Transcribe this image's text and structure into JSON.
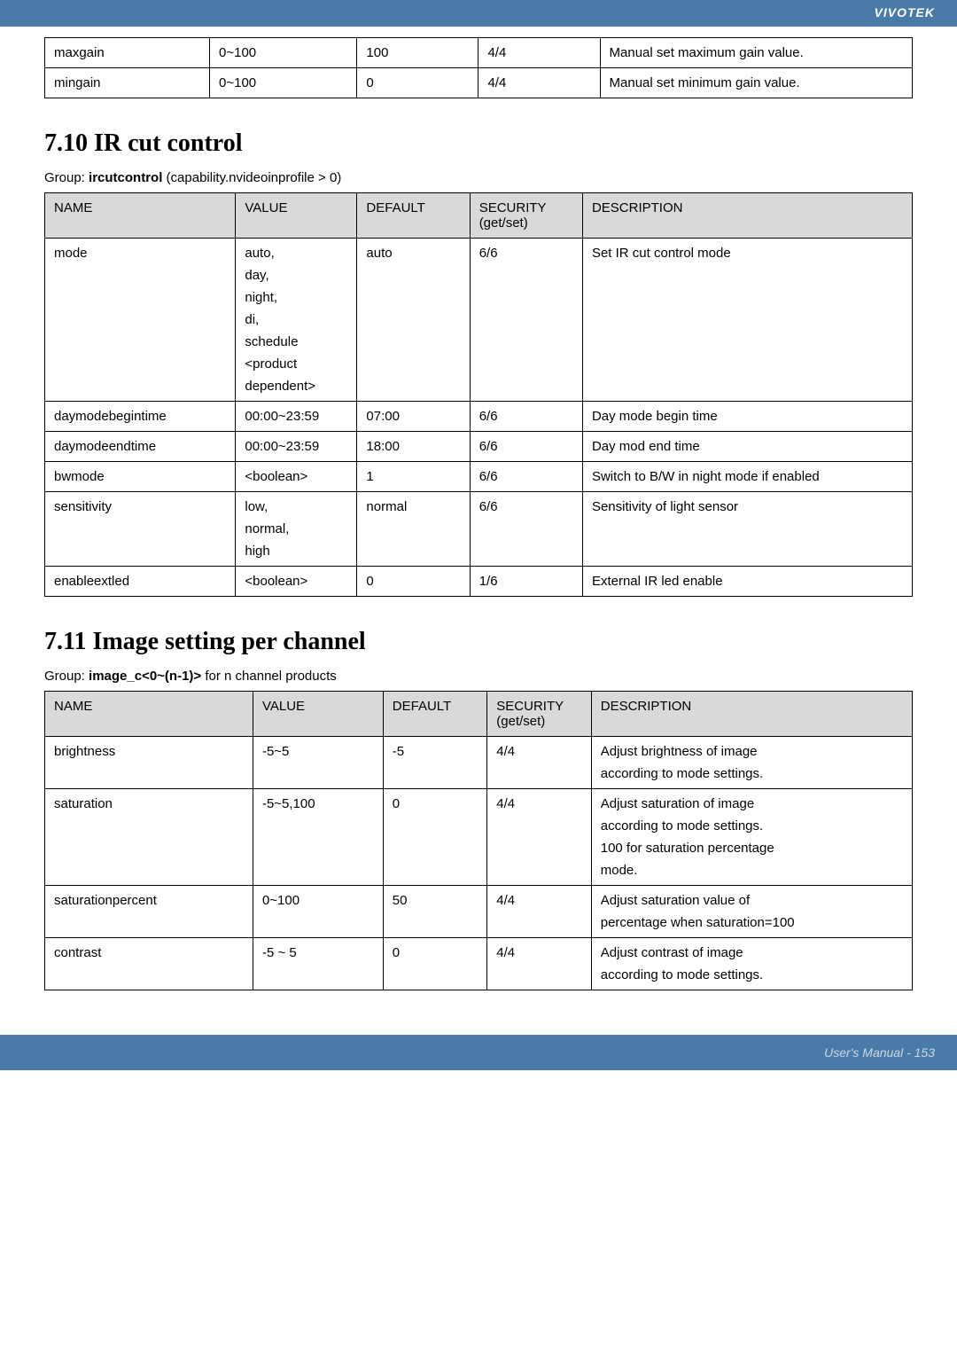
{
  "brand": "VIVOTEK",
  "footer": "User's Manual - 153",
  "table1": {
    "rows": [
      {
        "name": "maxgain",
        "value": "0~100",
        "default": "100",
        "security": "4/4",
        "desc": "Manual set maximum gain value."
      },
      {
        "name": "mingain",
        "value": "0~100",
        "default": "0",
        "security": "4/4",
        "desc": "Manual set minimum gain value."
      }
    ]
  },
  "section1": {
    "title": "7.10 IR cut control",
    "group_prefix": "Group: ",
    "group_name": "ircutcontrol",
    "group_suffix": " (capability.nvideoinprofile > 0)"
  },
  "table2": {
    "headers": {
      "col1": "NAME",
      "col2": "VALUE",
      "col3": "DEFAULT",
      "col4_1": "SECURITY",
      "col4_2": "(get/set)",
      "col5": "DESCRIPTION"
    },
    "rows": [
      {
        "name": "mode",
        "value": [
          "auto,",
          "day,",
          "night,",
          "di,",
          "schedule",
          "<product",
          "dependent>"
        ],
        "default": "auto",
        "security": "6/6",
        "desc": "Set IR cut control mode"
      },
      {
        "name": "daymodebegintime",
        "value": [
          "00:00~23:59"
        ],
        "default": "07:00",
        "security": "6/6",
        "desc": "Day mode begin time"
      },
      {
        "name": "daymodeendtime",
        "value": [
          "00:00~23:59"
        ],
        "default": "18:00",
        "security": "6/6",
        "desc": "Day mod end time"
      },
      {
        "name": "bwmode",
        "value": [
          "<boolean>"
        ],
        "default": "1",
        "security": "6/6",
        "desc": "Switch to B/W in night mode if enabled"
      },
      {
        "name": "sensitivity",
        "value": [
          "low,",
          "normal,",
          "high"
        ],
        "default": "normal",
        "security": "6/6",
        "desc": "Sensitivity of light sensor"
      },
      {
        "name": "enableextled",
        "value": [
          "<boolean>"
        ],
        "default": "0",
        "security": "1/6",
        "desc": "External IR led enable"
      }
    ]
  },
  "section2": {
    "title": "7.11 Image setting per channel",
    "group_prefix": "Group: ",
    "group_name": "image_c<0~(n-1)>",
    "group_suffix": " for n channel products"
  },
  "table3": {
    "headers": {
      "col1": "NAME",
      "col2": "VALUE",
      "col3": "DEFAULT",
      "col4_1": "SECURITY",
      "col4_2": "(get/set)",
      "col5": "DESCRIPTION"
    },
    "rows": [
      {
        "name": "brightness",
        "value": "-5~5",
        "default": "-5",
        "security": "4/4",
        "desc": [
          "Adjust brightness of image",
          "according to mode settings."
        ]
      },
      {
        "name": "saturation",
        "value": "-5~5,100",
        "default": "0",
        "security": "4/4",
        "desc": [
          "Adjust saturation of image",
          "according to mode settings.",
          "100 for saturation percentage",
          "mode."
        ]
      },
      {
        "name": "saturationpercent",
        "value": "0~100",
        "default": "50",
        "security": "4/4",
        "desc": [
          "Adjust saturation value of",
          "percentage when saturation=100"
        ]
      },
      {
        "name": "contrast",
        "value": "-5 ~ 5",
        "default": "0",
        "security": "4/4",
        "desc": [
          "Adjust contrast of image",
          "according to mode settings."
        ]
      }
    ]
  }
}
